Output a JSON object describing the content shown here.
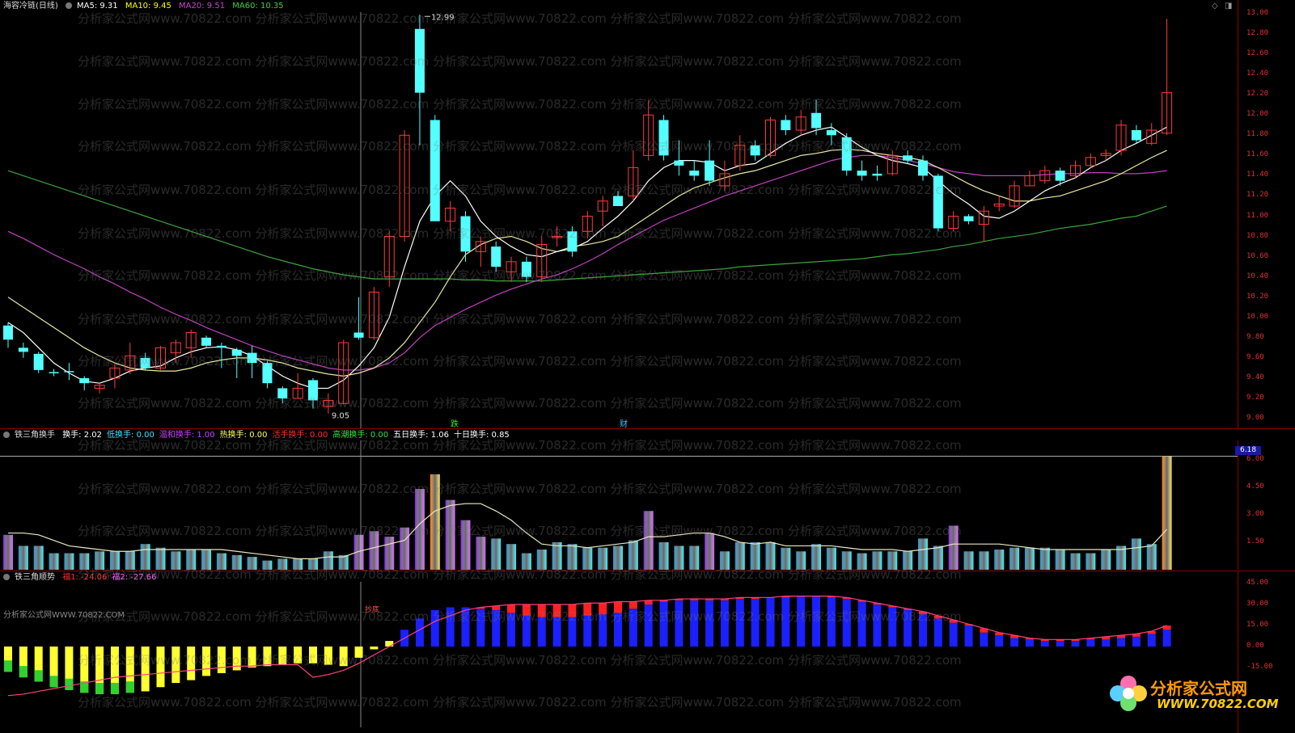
{
  "main_header": {
    "title": "海容冷链(日线)",
    "ma5": "MA5: 9.31",
    "ma10": "MA10: 9.45",
    "ma20": "MA20: 9.51",
    "ma60": "MA60: 10.35",
    "colors": {
      "ma5": "#ffffff",
      "ma10": "#ffff00",
      "ma20": "#d040d0",
      "ma60": "#40d040"
    }
  },
  "main_labels": {
    "high": "12.99",
    "low": "9.05",
    "marker1": "跌",
    "marker2": "财"
  },
  "main_axis": [
    "13.00",
    "12.80",
    "12.60",
    "12.40",
    "12.20",
    "12.00",
    "11.80",
    "11.60",
    "11.40",
    "11.20",
    "11.00",
    "10.80",
    "10.60",
    "10.40",
    "10.20",
    "10.00",
    "9.80",
    "9.60",
    "9.40",
    "9.20",
    "9.00"
  ],
  "vol_header": {
    "title": "铁三角换手",
    "items": [
      {
        "text": "换手: 2.02",
        "color": "#ffffff"
      },
      {
        "text": "低换手: 0.00",
        "color": "#40e0ff"
      },
      {
        "text": "温和换手: 1.00",
        "color": "#d040ff"
      },
      {
        "text": "热换手: 0.00",
        "color": "#ffff60"
      },
      {
        "text": "活手换手: 0.00",
        "color": "#ff3030"
      },
      {
        "text": "高潮换手: 0.00",
        "color": "#40e040"
      },
      {
        "text": "五日换手: 1.06",
        "color": "#ffffff"
      },
      {
        "text": "十日换手: 0.85",
        "color": "#ffffff"
      }
    ]
  },
  "vol_axis": [
    "6.00",
    "4.50",
    "3.00",
    "1.50"
  ],
  "vol_badge": "6.18",
  "trend_header": {
    "title": "铁三角顺势",
    "items": [
      {
        "text": "福1: -24.06",
        "color": "#ff3030"
      },
      {
        "text": "福2: -27.66",
        "color": "#ff60ff"
      }
    ],
    "tag1": "抄底",
    "site": "分析家公式网WWW.70822.COM"
  },
  "trend_axis": [
    "45.00",
    "30.00",
    "15.00",
    "0.00",
    "-15.00"
  ],
  "watermark": "分析家公式网www.70822.com 分析家公式网www.70822.com 分析家公式网www.70822.com 分析家公式网www.70822.com 分析家公式网www.70822.com",
  "logo": {
    "name": "分析家公式网",
    "url": "WWW.70822.COM"
  },
  "chart_data": {
    "type": "candlestick",
    "title": "海容冷链(日线)",
    "ylim": [
      9.0,
      13.0
    ],
    "candles": [
      [
        9.92,
        9.78,
        9.95,
        9.7
      ],
      [
        9.7,
        9.66,
        9.75,
        9.6
      ],
      [
        9.64,
        9.48,
        9.66,
        9.45
      ],
      [
        9.46,
        9.45,
        9.49,
        9.42
      ],
      [
        9.47,
        9.46,
        9.55,
        9.38
      ],
      [
        9.4,
        9.35,
        9.42,
        9.28
      ],
      [
        9.3,
        9.33,
        9.35,
        9.25
      ],
      [
        9.4,
        9.5,
        9.55,
        9.3
      ],
      [
        9.48,
        9.62,
        9.75,
        9.44
      ],
      [
        9.6,
        9.5,
        9.65,
        9.48
      ],
      [
        9.5,
        9.7,
        9.72,
        9.48
      ],
      [
        9.65,
        9.75,
        9.78,
        9.55
      ],
      [
        9.7,
        9.85,
        9.88,
        9.6
      ],
      [
        9.8,
        9.72,
        9.82,
        9.7
      ],
      [
        9.72,
        9.7,
        9.75,
        9.5
      ],
      [
        9.68,
        9.62,
        9.7,
        9.4
      ],
      [
        9.65,
        9.55,
        9.72,
        9.4
      ],
      [
        9.55,
        9.35,
        9.57,
        9.3
      ],
      [
        9.3,
        9.2,
        9.32,
        9.15
      ],
      [
        9.2,
        9.3,
        9.45,
        9.2
      ],
      [
        9.38,
        9.18,
        9.4,
        9.1
      ],
      [
        9.12,
        9.18,
        9.25,
        9.05
      ],
      [
        9.15,
        9.75,
        9.78,
        9.14
      ],
      [
        9.85,
        9.8,
        10.2,
        9.78
      ],
      [
        9.8,
        10.25,
        10.3,
        9.78
      ],
      [
        10.4,
        10.8,
        10.85,
        10.3
      ],
      [
        10.8,
        11.8,
        11.85,
        10.75
      ],
      [
        12.85,
        12.22,
        12.99,
        11.7
      ],
      [
        11.95,
        10.95,
        12.0,
        10.95
      ],
      [
        10.95,
        11.08,
        11.15,
        10.85
      ],
      [
        11.0,
        10.65,
        11.05,
        10.55
      ],
      [
        10.65,
        10.75,
        10.8,
        10.5
      ],
      [
        10.7,
        10.5,
        10.75,
        10.45
      ],
      [
        10.45,
        10.55,
        10.6,
        10.35
      ],
      [
        10.55,
        10.4,
        10.6,
        10.35
      ],
      [
        10.4,
        10.72,
        10.8,
        10.35
      ],
      [
        10.8,
        10.8,
        10.9,
        10.7
      ],
      [
        10.85,
        10.65,
        10.9,
        10.6
      ],
      [
        10.85,
        11.0,
        11.05,
        10.78
      ],
      [
        11.05,
        11.15,
        11.2,
        10.9
      ],
      [
        11.2,
        11.1,
        11.25,
        11.1
      ],
      [
        11.2,
        11.48,
        11.65,
        11.15
      ],
      [
        11.6,
        12.0,
        12.15,
        11.55
      ],
      [
        11.95,
        11.6,
        12.0,
        11.55
      ],
      [
        11.55,
        11.5,
        11.75,
        11.4
      ],
      [
        11.45,
        11.4,
        11.55,
        11.35
      ],
      [
        11.55,
        11.35,
        11.75,
        11.3
      ],
      [
        11.3,
        11.42,
        11.55,
        11.25
      ],
      [
        11.5,
        11.7,
        11.8,
        11.45
      ],
      [
        11.7,
        11.6,
        11.75,
        11.55
      ],
      [
        11.6,
        11.95,
        11.98,
        11.58
      ],
      [
        11.95,
        11.85,
        12.0,
        11.8
      ],
      [
        11.85,
        11.98,
        12.05,
        11.8
      ],
      [
        12.02,
        11.87,
        12.15,
        11.8
      ],
      [
        11.85,
        11.8,
        11.92,
        11.7
      ],
      [
        11.78,
        11.45,
        11.82,
        11.4
      ],
      [
        11.45,
        11.4,
        11.55,
        11.35
      ],
      [
        11.42,
        11.4,
        11.5,
        11.35
      ],
      [
        11.42,
        11.6,
        11.65,
        11.4
      ],
      [
        11.6,
        11.55,
        11.65,
        11.52
      ],
      [
        11.55,
        11.4,
        11.6,
        11.35
      ],
      [
        11.4,
        10.88,
        11.42,
        10.85
      ],
      [
        10.88,
        11.0,
        11.05,
        10.85
      ],
      [
        11.0,
        10.95,
        11.02,
        10.92
      ],
      [
        10.92,
        11.05,
        11.1,
        10.75
      ],
      [
        11.1,
        11.12,
        11.2,
        11.05
      ],
      [
        11.1,
        11.3,
        11.35,
        11.08
      ],
      [
        11.3,
        11.4,
        11.45,
        11.3
      ],
      [
        11.35,
        11.45,
        11.5,
        11.32
      ],
      [
        11.45,
        11.35,
        11.48,
        11.3
      ],
      [
        11.4,
        11.5,
        11.55,
        11.38
      ],
      [
        11.5,
        11.58,
        11.62,
        11.48
      ],
      [
        11.6,
        11.62,
        11.66,
        11.55
      ],
      [
        11.65,
        11.9,
        11.95,
        11.6
      ],
      [
        11.85,
        11.75,
        11.9,
        11.72
      ],
      [
        11.72,
        11.85,
        11.92,
        11.7
      ],
      [
        11.82,
        12.22,
        12.95,
        11.8
      ]
    ],
    "ma5": [
      9.95,
      9.85,
      9.7,
      9.55,
      9.45,
      9.37,
      9.35,
      9.4,
      9.47,
      9.5,
      9.52,
      9.6,
      9.66,
      9.7,
      9.71,
      9.68,
      9.62,
      9.52,
      9.42,
      9.35,
      9.3,
      9.3,
      9.38,
      9.52,
      9.7,
      10.0,
      10.5,
      10.95,
      11.2,
      11.35,
      11.2,
      10.95,
      10.8,
      10.7,
      10.62,
      10.6,
      10.65,
      10.68,
      10.75,
      10.88,
      11.0,
      11.15,
      11.35,
      11.48,
      11.55,
      11.55,
      11.53,
      11.45,
      11.5,
      11.52,
      11.62,
      11.72,
      11.8,
      11.85,
      11.88,
      11.78,
      11.68,
      11.6,
      11.55,
      11.52,
      11.48,
      11.35,
      11.22,
      11.12,
      11.0,
      10.98,
      11.05,
      11.15,
      11.25,
      11.32,
      11.38,
      11.48,
      11.55,
      11.65,
      11.72,
      11.8,
      11.88
    ],
    "ma10": [
      10.2,
      10.1,
      10.0,
      9.9,
      9.8,
      9.7,
      9.62,
      9.55,
      9.5,
      9.48,
      9.47,
      9.47,
      9.5,
      9.55,
      9.58,
      9.6,
      9.6,
      9.58,
      9.55,
      9.5,
      9.47,
      9.44,
      9.42,
      9.45,
      9.5,
      9.6,
      9.75,
      9.95,
      10.15,
      10.4,
      10.62,
      10.72,
      10.78,
      10.8,
      10.75,
      10.68,
      10.65,
      10.7,
      10.72,
      10.75,
      10.8,
      10.9,
      11.0,
      11.1,
      11.2,
      11.28,
      11.33,
      11.38,
      11.42,
      11.45,
      11.5,
      11.55,
      11.6,
      11.62,
      11.65,
      11.66,
      11.65,
      11.62,
      11.6,
      11.58,
      11.55,
      11.48,
      11.4,
      11.32,
      11.25,
      11.2,
      11.15,
      11.15,
      11.18,
      11.2,
      11.25,
      11.3,
      11.35,
      11.42,
      11.5,
      11.58,
      11.65
    ],
    "ma20": [
      10.85,
      10.78,
      10.7,
      10.62,
      10.55,
      10.48,
      10.4,
      10.33,
      10.25,
      10.18,
      10.1,
      10.03,
      9.97,
      9.9,
      9.84,
      9.78,
      9.72,
      9.67,
      9.62,
      9.58,
      9.54,
      9.5,
      9.48,
      9.48,
      9.5,
      9.55,
      9.65,
      9.8,
      9.92,
      10.0,
      10.08,
      10.15,
      10.22,
      10.28,
      10.33,
      10.38,
      10.42,
      10.48,
      10.55,
      10.63,
      10.72,
      10.8,
      10.88,
      10.96,
      11.02,
      11.08,
      11.14,
      11.2,
      11.25,
      11.3,
      11.35,
      11.4,
      11.45,
      11.5,
      11.55,
      11.58,
      11.6,
      11.6,
      11.58,
      11.55,
      11.52,
      11.48,
      11.44,
      11.42,
      11.4,
      11.4,
      11.4,
      11.4,
      11.41,
      11.42,
      11.42,
      11.43,
      11.43,
      11.42,
      11.42,
      11.43,
      11.45
    ],
    "ma60": [
      11.45,
      11.4,
      11.35,
      11.3,
      11.25,
      11.2,
      11.15,
      11.1,
      11.05,
      11.0,
      10.95,
      10.9,
      10.85,
      10.8,
      10.75,
      10.7,
      10.65,
      10.6,
      10.56,
      10.52,
      10.48,
      10.45,
      10.42,
      10.4,
      10.38,
      10.38,
      10.38,
      10.38,
      10.38,
      10.38,
      10.37,
      10.37,
      10.36,
      10.36,
      10.36,
      10.36,
      10.37,
      10.38,
      10.39,
      10.4,
      10.41,
      10.42,
      10.43,
      10.44,
      10.45,
      10.46,
      10.47,
      10.48,
      10.5,
      10.51,
      10.52,
      10.53,
      10.54,
      10.55,
      10.56,
      10.57,
      10.58,
      10.6,
      10.62,
      10.63,
      10.65,
      10.67,
      10.7,
      10.72,
      10.75,
      10.78,
      10.8,
      10.82,
      10.85,
      10.88,
      10.9,
      10.92,
      10.95,
      10.98,
      11.0,
      11.05,
      11.1
    ],
    "volume": [
      1.9,
      1.3,
      1.3,
      0.9,
      0.9,
      0.9,
      1.0,
      1.0,
      1.0,
      1.4,
      1.2,
      1.0,
      1.1,
      1.1,
      0.9,
      0.8,
      0.7,
      0.5,
      0.6,
      0.6,
      0.6,
      1.0,
      0.8,
      1.9,
      2.1,
      1.8,
      2.3,
      4.4,
      5.2,
      3.8,
      2.7,
      1.8,
      1.7,
      1.4,
      0.9,
      1.1,
      1.5,
      1.4,
      1.2,
      1.2,
      1.3,
      1.6,
      3.2,
      1.5,
      1.3,
      1.3,
      2.0,
      1.0,
      1.5,
      1.5,
      1.5,
      1.2,
      1.0,
      1.4,
      1.2,
      1.0,
      0.9,
      1.0,
      1.0,
      1.0,
      1.7,
      1.3,
      2.4,
      1.0,
      1.0,
      1.1,
      1.2,
      1.2,
      1.2,
      1.1,
      0.9,
      0.9,
      1.1,
      1.3,
      1.7,
      1.4,
      6.18
    ],
    "vol_ma5": [
      2.0,
      2.0,
      1.9,
      1.6,
      1.3,
      1.2,
      1.1,
      1.0,
      1.0,
      1.1,
      1.1,
      1.1,
      1.1,
      1.1,
      1.1,
      1.0,
      0.9,
      0.8,
      0.7,
      0.6,
      0.6,
      0.7,
      0.7,
      1.0,
      1.2,
      1.4,
      1.6,
      2.5,
      3.2,
      3.5,
      3.6,
      3.6,
      3.2,
      2.7,
      2.0,
      1.4,
      1.3,
      1.3,
      1.2,
      1.3,
      1.4,
      1.5,
      1.8,
      1.8,
      1.9,
      2.0,
      2.0,
      1.8,
      1.5,
      1.4,
      1.5,
      1.3,
      1.3,
      1.3,
      1.3,
      1.2,
      1.1,
      1.1,
      1.1,
      1.0,
      1.1,
      1.2,
      1.4,
      1.4,
      1.4,
      1.4,
      1.3,
      1.2,
      1.1,
      1.1,
      1.1,
      1.1,
      1.1,
      1.1,
      1.2,
      1.3,
      2.2
    ],
    "trend": [
      -18,
      -22,
      -25,
      -29,
      -31,
      -33,
      -34,
      -34,
      -33,
      -32,
      -29,
      -26,
      -24,
      -21,
      -19,
      -17,
      -15,
      -14,
      -13,
      -12,
      -12,
      -13,
      -14,
      -8,
      -2,
      4,
      12,
      20,
      26,
      28,
      28,
      27,
      26,
      24,
      22,
      21,
      21,
      21,
      22,
      23,
      24,
      27,
      30,
      32,
      33,
      33,
      33,
      33,
      34,
      34,
      35,
      35,
      36,
      36,
      35,
      34,
      32,
      30,
      28,
      26,
      23,
      20,
      17,
      15,
      10,
      8,
      6,
      5,
      4,
      4,
      4,
      5,
      5,
      6,
      7,
      9,
      12
    ],
    "trend_line": [
      -35,
      -34,
      -32,
      -30,
      -28,
      -26,
      -24,
      -22,
      -21,
      -20,
      -19,
      -18,
      -17,
      -16,
      -15,
      -14,
      -14,
      -13,
      -13,
      -13,
      -22,
      -20,
      -17,
      -12,
      -6,
      0,
      6,
      12,
      18,
      22,
      26,
      28,
      29,
      30,
      30,
      30,
      30,
      30,
      31,
      31,
      32,
      32,
      33,
      33,
      34,
      34,
      34,
      34,
      35,
      35,
      35,
      36,
      36,
      36,
      36,
      35,
      33,
      31,
      29,
      27,
      25,
      22,
      19,
      16,
      13,
      10,
      8,
      6,
      5,
      5,
      5,
      6,
      7,
      8,
      9,
      11,
      15
    ]
  }
}
